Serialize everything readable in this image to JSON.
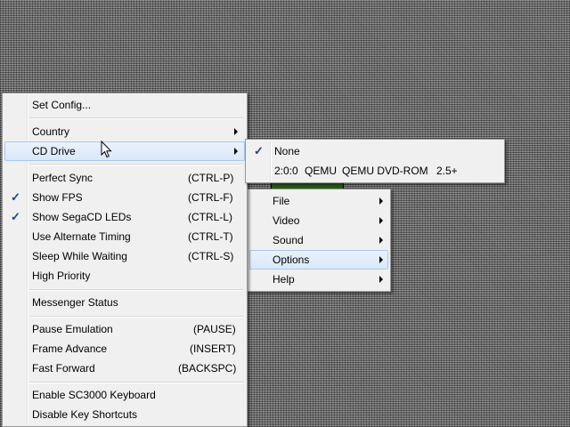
{
  "main_menu": {
    "items": [
      {
        "label": "File"
      },
      {
        "label": "Video"
      },
      {
        "label": "Sound"
      },
      {
        "label": "Options"
      },
      {
        "label": "Help"
      }
    ]
  },
  "options_menu": {
    "set_config": "Set Config...",
    "country": "Country",
    "cd_drive": "CD Drive",
    "perfect_sync": {
      "label": "Perfect Sync",
      "shortcut": "(CTRL-P)"
    },
    "show_fps": {
      "label": "Show FPS",
      "shortcut": "(CTRL-F)"
    },
    "show_segacd_leds": {
      "label": "Show SegaCD LEDs",
      "shortcut": "(CTRL-L)"
    },
    "alt_timing": {
      "label": "Use Alternate Timing",
      "shortcut": "(CTRL-T)"
    },
    "sleep_waiting": {
      "label": "Sleep While Waiting",
      "shortcut": "(CTRL-S)"
    },
    "high_priority": {
      "label": "High Priority"
    },
    "messenger_status": {
      "label": "Messenger Status"
    },
    "pause": {
      "label": "Pause Emulation",
      "shortcut": "(PAUSE)"
    },
    "frame_advance": {
      "label": "Frame Advance",
      "shortcut": "(INSERT)"
    },
    "fast_forward": {
      "label": "Fast Forward",
      "shortcut": "(BACKSPC)"
    },
    "sc3000_keyboard": {
      "label": "Enable SC3000 Keyboard"
    },
    "disable_shortcuts": {
      "label": "Disable Key Shortcuts"
    },
    "checked": [
      "Show FPS",
      "Show SegaCD LEDs"
    ]
  },
  "cd_drive_menu": {
    "none": "None",
    "drive": {
      "address": "2:0:0",
      "vendor": "QEMU",
      "model": "QEMU DVD-ROM",
      "rev": "2.5+"
    }
  },
  "check_glyph": "✓",
  "colors": {
    "highlight": "#d9e8f9",
    "highlight_border": "#a9c8ec",
    "menu_bg": "#f0f0f0"
  }
}
